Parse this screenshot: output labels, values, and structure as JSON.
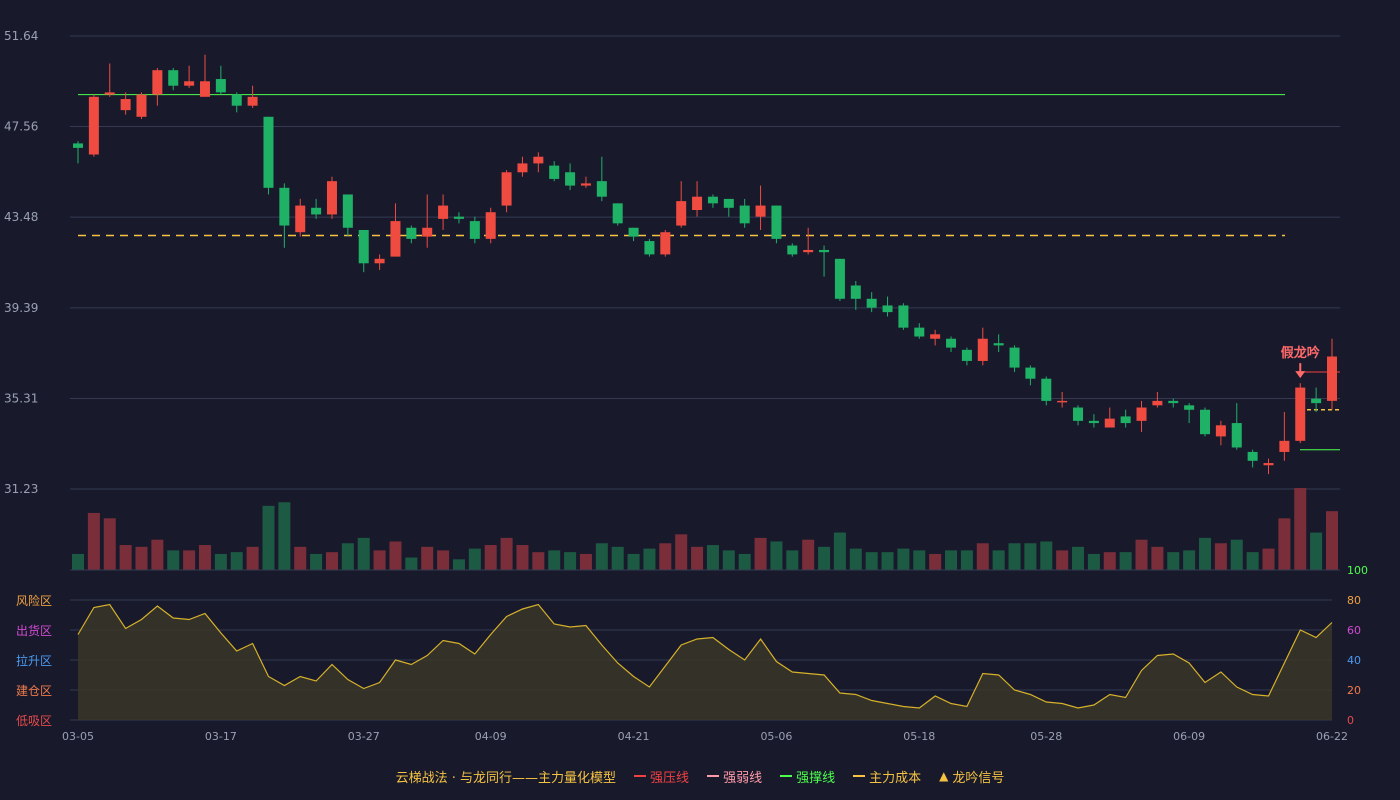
{
  "chart_data": {
    "type": "candlestick",
    "price_axis": {
      "ticks": [
        51.64,
        47.56,
        43.48,
        39.39,
        35.31,
        31.23
      ],
      "ylim": [
        31.23,
        51.64
      ]
    },
    "x_ticks": [
      "03-05",
      "03-17",
      "03-27",
      "04-09",
      "04-21",
      "05-06",
      "05-18",
      "05-28",
      "06-09",
      "06-22"
    ],
    "candles": [
      [
        46.8,
        46.6,
        46.9,
        45.9
      ],
      [
        46.3,
        48.9,
        49.0,
        46.2
      ],
      [
        49.0,
        49.1,
        50.4,
        48.9
      ],
      [
        48.3,
        48.8,
        49.1,
        48.1
      ],
      [
        48.0,
        49.0,
        49.1,
        47.9
      ],
      [
        49.0,
        50.1,
        50.2,
        48.5
      ],
      [
        50.1,
        49.4,
        50.2,
        49.2
      ],
      [
        49.4,
        49.6,
        50.3,
        49.3
      ],
      [
        48.9,
        49.6,
        50.8,
        48.9
      ],
      [
        49.7,
        49.1,
        50.3,
        49.0
      ],
      [
        49.0,
        48.5,
        49.1,
        48.2
      ],
      [
        48.5,
        48.9,
        49.4,
        48.4
      ],
      [
        48.0,
        44.8,
        48.0,
        44.5
      ],
      [
        44.8,
        43.1,
        45.0,
        42.1
      ],
      [
        42.8,
        44.0,
        44.3,
        42.6
      ],
      [
        43.9,
        43.6,
        44.3,
        43.4
      ],
      [
        43.6,
        45.1,
        45.3,
        43.4
      ],
      [
        44.5,
        43.0,
        44.5,
        42.6
      ],
      [
        42.9,
        41.4,
        42.9,
        41.0
      ],
      [
        41.4,
        41.6,
        41.8,
        41.1
      ],
      [
        41.7,
        43.3,
        44.1,
        41.7
      ],
      [
        43.0,
        42.5,
        43.1,
        42.3
      ],
      [
        42.6,
        43.0,
        44.5,
        42.1
      ],
      [
        43.4,
        44.0,
        44.5,
        42.9
      ],
      [
        43.5,
        43.4,
        43.7,
        43.2
      ],
      [
        43.3,
        42.5,
        43.5,
        42.3
      ],
      [
        42.5,
        43.7,
        43.9,
        42.3
      ],
      [
        44.0,
        45.5,
        45.6,
        43.7
      ],
      [
        45.5,
        45.9,
        46.2,
        45.3
      ],
      [
        45.9,
        46.2,
        46.4,
        45.5
      ],
      [
        45.8,
        45.2,
        46.0,
        45.1
      ],
      [
        45.5,
        44.9,
        45.9,
        44.7
      ],
      [
        44.9,
        45.0,
        45.3,
        44.8
      ],
      [
        45.1,
        44.4,
        46.2,
        44.2
      ],
      [
        44.1,
        43.2,
        44.1,
        43.1
      ],
      [
        43.0,
        42.6,
        43.0,
        42.4
      ],
      [
        42.4,
        41.8,
        42.5,
        41.7
      ],
      [
        41.8,
        42.8,
        42.9,
        41.7
      ],
      [
        43.1,
        44.2,
        45.1,
        43.0
      ],
      [
        43.8,
        44.4,
        45.1,
        43.5
      ],
      [
        44.4,
        44.1,
        44.5,
        43.9
      ],
      [
        44.3,
        43.9,
        44.3,
        43.5
      ],
      [
        44.0,
        43.2,
        44.3,
        43.0
      ],
      [
        43.5,
        44.0,
        44.9,
        42.9
      ],
      [
        44.0,
        42.5,
        44.0,
        42.3
      ],
      [
        42.2,
        41.8,
        42.3,
        41.7
      ],
      [
        41.9,
        42.0,
        43.0,
        41.8
      ],
      [
        42.0,
        41.9,
        42.2,
        40.8
      ],
      [
        41.6,
        39.8,
        41.6,
        39.7
      ],
      [
        40.4,
        39.8,
        40.6,
        39.3
      ],
      [
        39.8,
        39.4,
        40.1,
        39.2
      ],
      [
        39.5,
        39.2,
        39.9,
        39.0
      ],
      [
        39.5,
        38.5,
        39.6,
        38.4
      ],
      [
        38.5,
        38.1,
        38.7,
        38.0
      ],
      [
        38.0,
        38.2,
        38.4,
        37.7
      ],
      [
        38.0,
        37.6,
        38.1,
        37.4
      ],
      [
        37.5,
        37.0,
        37.6,
        36.8
      ],
      [
        37.0,
        38.0,
        38.5,
        36.8
      ],
      [
        37.8,
        37.7,
        38.2,
        37.4
      ],
      [
        37.6,
        36.7,
        37.7,
        36.5
      ],
      [
        36.7,
        36.2,
        36.8,
        35.9
      ],
      [
        36.2,
        35.2,
        36.3,
        35.0
      ],
      [
        35.2,
        35.2,
        35.6,
        34.9
      ],
      [
        34.9,
        34.3,
        35.0,
        34.1
      ],
      [
        34.3,
        34.2,
        34.6,
        34.0
      ],
      [
        34.0,
        34.4,
        34.9,
        34.0
      ],
      [
        34.5,
        34.2,
        34.8,
        34.0
      ],
      [
        34.3,
        34.9,
        35.2,
        33.8
      ],
      [
        35.0,
        35.2,
        35.6,
        34.9
      ],
      [
        35.2,
        35.1,
        35.3,
        34.9
      ],
      [
        35.0,
        34.8,
        35.1,
        34.2
      ],
      [
        34.8,
        33.7,
        34.9,
        33.6
      ],
      [
        33.6,
        34.1,
        34.3,
        33.2
      ],
      [
        34.2,
        33.1,
        35.1,
        33.0
      ],
      [
        32.9,
        32.5,
        33.0,
        32.2
      ],
      [
        32.3,
        32.4,
        32.6,
        31.9
      ],
      [
        32.9,
        33.4,
        34.7,
        32.5
      ],
      [
        33.4,
        35.8,
        36.0,
        33.3
      ],
      [
        35.3,
        35.1,
        35.8,
        34.7
      ],
      [
        35.2,
        37.2,
        38.0,
        34.8
      ]
    ],
    "volume": [
      18,
      64,
      58,
      28,
      26,
      34,
      22,
      22,
      28,
      18,
      20,
      26,
      72,
      76,
      26,
      18,
      20,
      30,
      36,
      22,
      32,
      14,
      26,
      22,
      12,
      24,
      28,
      36,
      28,
      20,
      22,
      20,
      18,
      30,
      26,
      18,
      24,
      30,
      40,
      26,
      28,
      22,
      18,
      36,
      32,
      22,
      34,
      26,
      42,
      24,
      20,
      20,
      24,
      22,
      18,
      22,
      22,
      30,
      22,
      30,
      30,
      32,
      22,
      26,
      18,
      20,
      20,
      34,
      26,
      20,
      22,
      36,
      30,
      34,
      20,
      24,
      58,
      92,
      42,
      66
    ],
    "oscillator": {
      "range": [
        0,
        100
      ],
      "ticks": [
        0,
        20,
        40,
        60,
        80,
        100
      ],
      "zones": [
        "风险区",
        "出货区",
        "拉升区",
        "建仓区",
        "低吸区"
      ],
      "values": [
        57,
        75,
        77,
        61,
        67,
        76,
        68,
        67,
        71,
        58,
        46,
        51,
        29,
        23,
        29,
        26,
        37,
        27,
        21,
        25,
        40,
        37,
        43,
        53,
        51,
        44,
        57,
        69,
        74,
        77,
        64,
        62,
        63,
        50,
        38,
        29,
        22,
        36,
        50,
        54,
        55,
        47,
        40,
        54,
        39,
        32,
        31,
        30,
        18,
        17,
        13,
        11,
        9,
        8,
        16,
        11,
        9,
        31,
        30,
        20,
        17,
        12,
        11,
        8,
        10,
        17,
        15,
        33,
        43,
        44,
        38,
        25,
        32,
        22,
        17,
        16,
        38,
        60,
        55,
        65
      ]
    },
    "lines": {
      "strong_resistance": 49.0,
      "main_cost": 42.65,
      "short_support": 33.0,
      "short_resistance": 36.5,
      "short_cost": 34.8
    },
    "annotation": {
      "text": "假龙吟",
      "at_index": 77
    }
  },
  "legend": {
    "title": "云梯战法 · 与龙同行——主力量化模型",
    "items": [
      {
        "label": "强压线",
        "color": "#f04040",
        "style": "solid"
      },
      {
        "label": "强弱线",
        "color": "#ff9aa8",
        "style": "dash"
      },
      {
        "label": "强撑线",
        "color": "#4cff4c",
        "style": "solid"
      },
      {
        "label": "主力成本",
        "color": "#f5c242",
        "style": "dash"
      },
      {
        "label": "龙吟信号",
        "color": "#f5c242",
        "style": "triangle",
        "glyph": "▲"
      }
    ]
  },
  "colors": {
    "up": "#ef4b40",
    "down": "#1fb267",
    "grid": "#353a52",
    "axis_text": "#9aa0b4",
    "osc_line": "#d6b12a",
    "title": "#f5c242"
  }
}
